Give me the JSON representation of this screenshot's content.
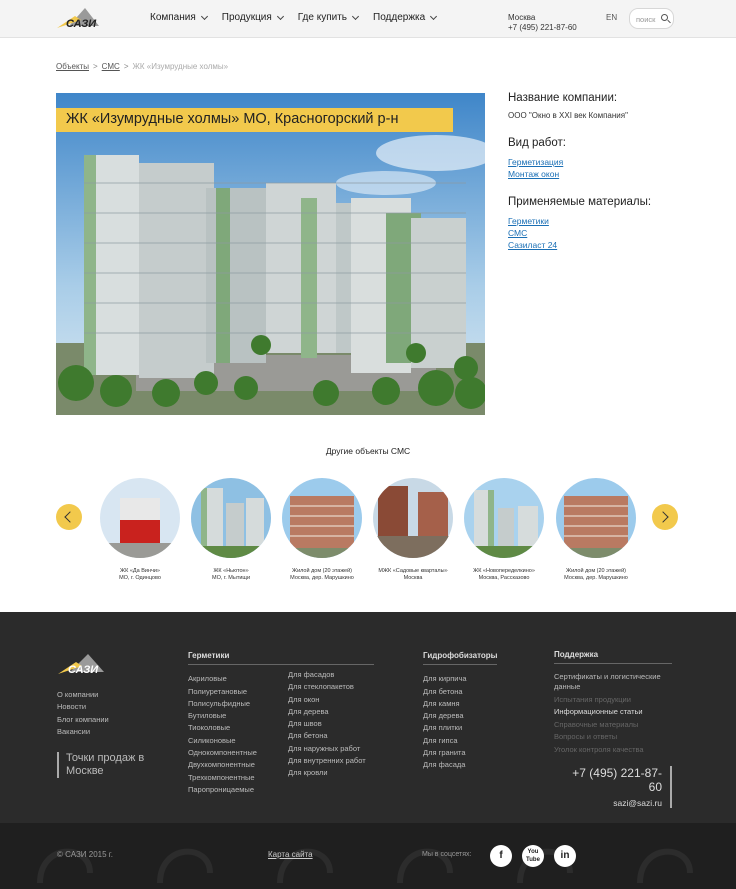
{
  "header": {
    "nav": [
      "Компания",
      "Продукция",
      "Где купить",
      "Поддержка"
    ],
    "city": "Москва",
    "phone": "+7 (495) 221-87-60",
    "lang": "EN",
    "search_placeholder": "поиск"
  },
  "logo_text": "САЗИ",
  "breadcrumbs": {
    "item1": "Объекты",
    "item2": "СМС",
    "current": "ЖК «Изумрудные холмы»"
  },
  "object_title": "ЖК «Изумрудные холмы» МО, Красногорский р-н",
  "info": {
    "company_label": "Название компании:",
    "company_value": "ООО \"Окно в XXI век Компания\"",
    "works_label": "Вид работ:",
    "works": [
      "Герметизация",
      "Монтаж окон"
    ],
    "materials_label": "Применяемые материалы:",
    "materials": [
      "Герметики",
      "СМС",
      "Сазиласт 24"
    ]
  },
  "other_title": "Другие объекты СМС",
  "others": [
    {
      "line1": "ЖК «Да Винчи»",
      "line2": "МО, г. Одинцово"
    },
    {
      "line1": "ЖК «Ньютон»",
      "line2": "МО, г. Мытищи"
    },
    {
      "line1": "Жилой дом (20 этажей)",
      "line2": "Москва, дер. Марушкино"
    },
    {
      "line1": "МЖК «Садовые кварталы»",
      "line2": "Москва"
    },
    {
      "line1": "ЖК «Новопеределкино»",
      "line2": "Москва, Рассказово"
    },
    {
      "line1": "Жилой дом (20 этажей)",
      "line2": "Москва, дер. Марушкино"
    }
  ],
  "footer": {
    "about": [
      "О компании",
      "Новости",
      "Блог компании",
      "Вакансии"
    ],
    "points": "Точки продаж в Москве",
    "sealants_title": "Герметики",
    "sealants_col1": [
      "Акриловые",
      "Полиуретановые",
      "Полисульфидные",
      "Бутиловые",
      "Тиоколовые",
      "Силиконовые",
      "Однокомпонентные",
      "Двухкомпонентные",
      "Трехкомпонентные",
      "Паропроницаемые"
    ],
    "sealants_col2": [
      "Для фасадов",
      "Для стеклопакетов",
      "Для окон",
      "Для дерева",
      "Для швов",
      "Для бетона",
      "Для наружных работ",
      "Для внутренних работ",
      "Для кровли"
    ],
    "hydro_title": "Гидрофобизаторы",
    "hydro": [
      "Для кирпича",
      "Для бетона",
      "Для камня",
      "Для дерева",
      "Для плитки",
      "Для гипса",
      "Для гранита",
      "Для фасада"
    ],
    "support_title": "Поддержка",
    "support": [
      "Сертификаты и логистические данные",
      "Испытания продукции",
      "Информационные статьи",
      "Справочные материалы",
      "Вопросы и ответы",
      "Уголок контроля качества"
    ],
    "phone": "+7 (495) 221-87-60",
    "email": "sazi@sazi.ru",
    "copyright": "© САЗИ 2015 г.",
    "sitemap": "Карта сайта",
    "social_label": "Мы в соцсетях:",
    "social": [
      "f",
      "You Tube",
      "in"
    ]
  },
  "colors": {
    "accent": "#f2c94c",
    "footer": "#2b2b2b",
    "link": "#1a6fb5"
  }
}
